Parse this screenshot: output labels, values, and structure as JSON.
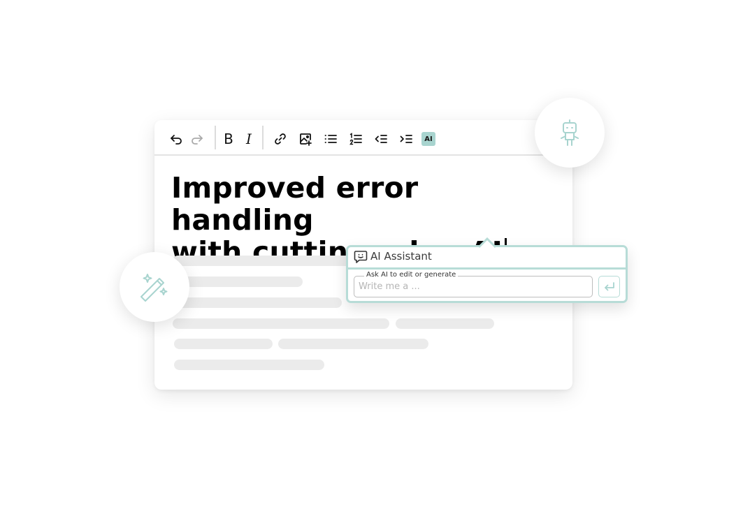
{
  "toolbar": {
    "buttons": [
      {
        "name": "undo",
        "icon": "undo-icon"
      },
      {
        "name": "redo",
        "icon": "redo-icon"
      },
      {
        "name": "bold",
        "icon": "bold-icon",
        "label": "B"
      },
      {
        "name": "italic",
        "icon": "italic-icon",
        "label": "I"
      },
      {
        "name": "link",
        "icon": "link-icon"
      },
      {
        "name": "insert-image",
        "icon": "image-add-icon"
      },
      {
        "name": "bullet-list",
        "icon": "bullet-list-icon"
      },
      {
        "name": "numbered-list",
        "icon": "numbered-list-icon"
      },
      {
        "name": "outdent",
        "icon": "outdent-icon"
      },
      {
        "name": "indent",
        "icon": "indent-icon"
      },
      {
        "name": "ai",
        "icon": "ai-icon",
        "label": "AI"
      }
    ],
    "bold_label": "B",
    "italic_label": "I",
    "ai_label": "AI"
  },
  "document": {
    "title_line1": "Improved error handling",
    "title_line2": "with cutting edge AI"
  },
  "ai_assistant": {
    "title": "AI Assistant",
    "field_label": "Ask AI to edit or generate",
    "placeholder": "Write me a ...",
    "value": ""
  },
  "colors": {
    "accent": "#b7dcd7",
    "ai_badge": "#a8d4cf",
    "skeleton": "#ebebeb"
  }
}
